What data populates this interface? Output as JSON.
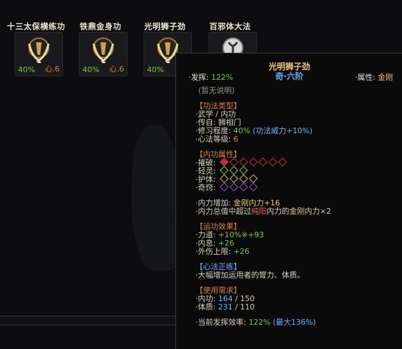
{
  "skills": [
    {
      "name": "十三太保横练功",
      "pct": "40%",
      "lvl": "心.6"
    },
    {
      "name": "铁鼎金身功",
      "pct": "40%",
      "lvl": "心.6"
    },
    {
      "name": "光明狮子劲",
      "pct": "40%",
      "lvl": ""
    },
    {
      "name": "百邪体大法",
      "pct": "",
      "lvl": ""
    }
  ],
  "tooltip": {
    "title": "光明狮子劲",
    "rank": "奇·六阶",
    "perf_label": "·发挥: ",
    "perf_value": "122%",
    "attr_label": "·属性: ",
    "attr_value": "金刚",
    "desc": "(暂无说明)",
    "sec1": "【功法类型】",
    "type_line": "·武学 / 内功",
    "source_line": "·传自: 狮相门",
    "mastery_label": "·修习程度: ",
    "mastery_value": "40%",
    "mastery_bonus": "(功法威力+10%)",
    "level_label": "·心法等级: ",
    "level_value": "6",
    "sec2": "【内功属性】",
    "attrs": [
      {
        "label": "·摧破: ",
        "filled": 1,
        "total": 7,
        "color": "#c0303a"
      },
      {
        "label": "·轻灵: ",
        "filled": 0,
        "total": 3,
        "color": "#7fc24a"
      },
      {
        "label": "·护体: ",
        "filled": 0,
        "total": 4,
        "color": "#c8c04a"
      },
      {
        "label": "·奇窍: ",
        "filled": 0,
        "total": 4,
        "color": "#8a5ac0"
      }
    ],
    "inner_label": "·内力增加: ",
    "inner_value": "金刚内力+16",
    "inner_note_a": "·内力总值中超过",
    "inner_note_red": "纯阳",
    "inner_note_b": "内力的",
    "inner_note_yellow": "金刚",
    "inner_note_c": "内力×2",
    "sec3": "【运功效果】",
    "eff1_label": "·力道: ",
    "eff1_value": "+10%※+93",
    "eff2_label": "·内息: ",
    "eff2_value": "+26",
    "eff3_label": "·外伤上限: ",
    "eff3_value": "+26",
    "sec4": "【心法正练】",
    "practice": "·大幅增加运用者的膂力、体质。",
    "sec5": "【使用需求】",
    "req1_label": "·内功: ",
    "req1_have": "164",
    "req1_need": " / 150",
    "req2_label": "·体质: ",
    "req2_have": "231",
    "req2_need": " / 110",
    "eff_label": "·当前发挥效率: ",
    "eff_value": "122%",
    "eff_max": "(最大136%)"
  }
}
